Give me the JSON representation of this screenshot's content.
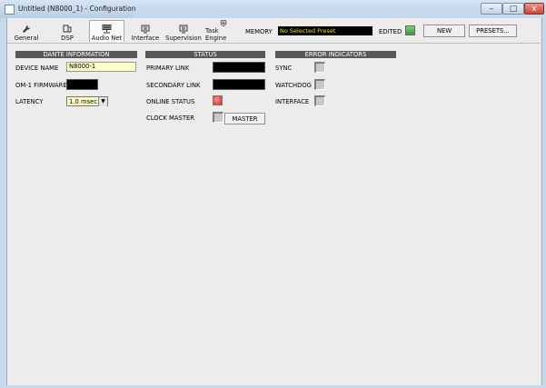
{
  "window": {
    "title": "Untitled (N8000_1) - Configuration",
    "min": "–",
    "max": "□",
    "close": "x"
  },
  "toolbar": {
    "tabs": [
      "General",
      "DSP",
      "Audio Net",
      "Interface",
      "Supervision",
      "Task Engine"
    ],
    "active_tab": "Audio Net",
    "memory_label": "MEMORY",
    "memory_value": "No Selected Preset",
    "edited_label": "EDITED",
    "new_label": "NEW",
    "presets_label": "PRESETS..."
  },
  "dante": {
    "header": "DANTE INFORMATION",
    "device_name_label": "DEVICE NAME",
    "device_name_value": "N8000-1",
    "firmware_label": "OM-1 FIRMWARE",
    "latency_label": "LATENCY",
    "latency_value": "1.0 msec"
  },
  "status": {
    "header": "STATUS",
    "primary_label": "PRIMARY LINK",
    "secondary_label": "SECONDARY LINK",
    "online_label": "ONLINE STATUS",
    "clock_label": "CLOCK MASTER",
    "master_button": "MASTER"
  },
  "errors": {
    "header": "ERROR INDICATORS",
    "sync_label": "SYNC",
    "watchdog_label": "WATCHDOG",
    "interface_label": "INTERFACE"
  },
  "colors": {
    "memory_text": "#e6e200",
    "edited_led": "#2f9c3a",
    "online_led": "#e02020",
    "field_yellow": "#ffffc6",
    "header_bg": "#585858"
  }
}
